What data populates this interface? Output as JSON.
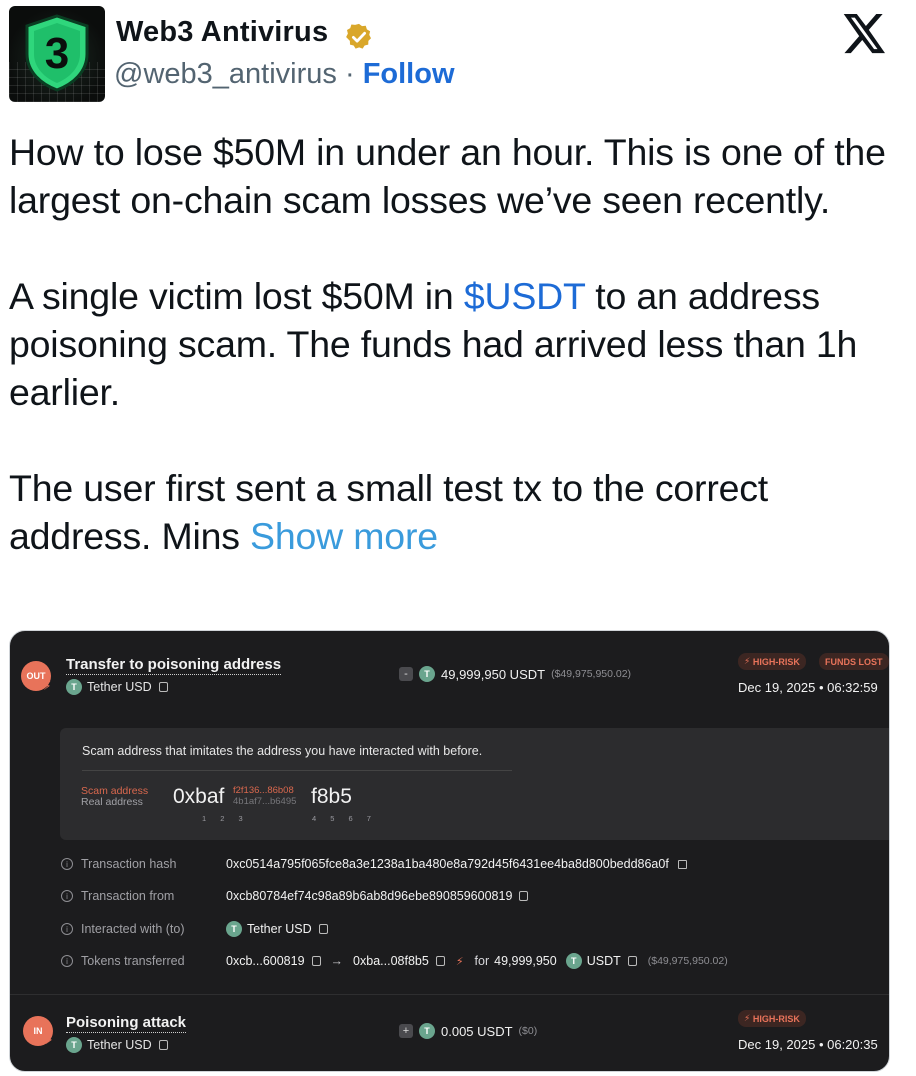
{
  "account": {
    "name": "Web3 Antivirus",
    "handle": "@web3_antivirus",
    "separator": "·",
    "follow_label": "Follow",
    "avatar_glyph": "3"
  },
  "tweet": {
    "p1": "How to lose $50M in under an hour. This is one of the largest on-chain scam losses we’ve seen recently.",
    "p2_before": "A single victim lost $50M in ",
    "p2_cashtag": "$USDT",
    "p2_after": " to an address poisoning scam. The funds had arrived less than 1h earlier.",
    "p3": "The user first sent a small test tx to the correct address. Mins ",
    "show_more": "Show more"
  },
  "card": {
    "tx1": {
      "direction": "OUT",
      "title": "Transfer to poisoning address",
      "token_coin": "T",
      "token_name": "Tether USD",
      "sign": "-",
      "amount": "49,999,950 USDT",
      "amount_usd": "($49,975,950.02)",
      "badges": [
        "HIGH-RISK",
        "FUNDS LOST"
      ],
      "datetime": "Dec 19, 2025 • 06:32:59"
    },
    "scam_panel": {
      "message": "Scam address that imitates the address you have interacted with before.",
      "scam_label": "Scam address",
      "real_label": "Real address",
      "prefix": "0xbaf",
      "scam_middle": "f2f136...86b08",
      "real_middle": "4b1af7...b6495",
      "suffix": "f8b5",
      "left_indices": "1 2 3",
      "right_indices": "4 5 6 7"
    },
    "details": {
      "hash_label": "Transaction hash",
      "hash_value": "0xc0514a795f065fce8a3e1238a1ba480e8a792d45f6431ee4ba8d800bedd86a0f",
      "from_label": "Transaction from",
      "from_value": "0xcb80784ef74c98a89b6ab8d96ebe890859600819",
      "to_label": "Interacted with (to)",
      "to_value": "Tether USD",
      "tokens_label": "Tokens transferred",
      "tokens_from": "0xcb...600819",
      "tokens_to": "0xba...08f8b5",
      "tokens_for": "for",
      "tokens_amount": "49,999,950",
      "tokens_symbol": "USDT",
      "tokens_usd": "($49,975,950.02)"
    },
    "tx2": {
      "direction": "IN",
      "title": "Poisoning attack",
      "token_name": "Tether USD",
      "sign": "+",
      "amount": "0.005 USDT",
      "amount_usd": "($0)",
      "badge": "HIGH-RISK",
      "datetime": "Dec 19, 2025 • 06:20:35"
    }
  }
}
